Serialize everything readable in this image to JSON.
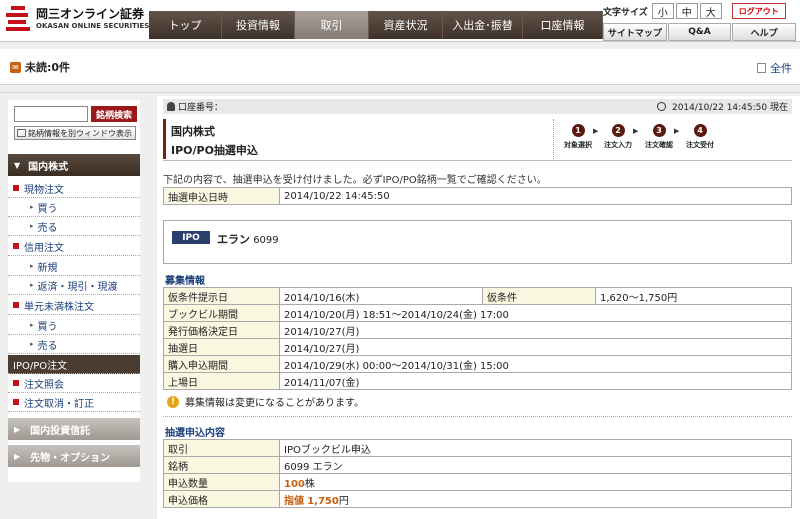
{
  "header": {
    "logo_jp": "岡三オンライン証券",
    "logo_en": "OKASAN ONLINE SECURITIES",
    "nav": [
      {
        "label": "トップ",
        "w": 73
      },
      {
        "label": "投資情報",
        "w": 73
      },
      {
        "label": "取引",
        "w": 74,
        "active": true
      },
      {
        "label": "資産状況",
        "w": 74
      },
      {
        "label": "入出金･振替",
        "w": 80
      },
      {
        "label": "口座情報",
        "w": 80
      }
    ],
    "font_size_label": "文字サイズ",
    "font_sizes": [
      "小",
      "中",
      "大"
    ],
    "logout": "ログアウト",
    "sub_links": [
      "サイトマップ",
      "Q&A",
      "ヘルプ"
    ]
  },
  "notice": {
    "unread": "未読:0件",
    "all": "全件"
  },
  "sidebar": {
    "search_btn": "銘柄検索",
    "search_placeholder": "",
    "window_btn": "銘柄情報を別ウィンドウ表示",
    "section_domestic": "国内株式",
    "items": [
      {
        "label": "現物注文",
        "level": 1
      },
      {
        "label": "買う",
        "level": 2
      },
      {
        "label": "売る",
        "level": 2
      },
      {
        "label": "信用注文",
        "level": 1
      },
      {
        "label": "新規",
        "level": 2
      },
      {
        "label": "返済・現引・現渡",
        "level": 2
      },
      {
        "label": "単元未満株注文",
        "level": 1
      },
      {
        "label": "買う",
        "level": 2
      },
      {
        "label": "売る",
        "level": 2
      },
      {
        "label": "IPO/PO注文",
        "level": 1,
        "active": true
      },
      {
        "label": "注文照会",
        "level": 1
      },
      {
        "label": "注文取消・訂正",
        "level": 1
      }
    ],
    "section_trust": "国内投資信託",
    "section_futures": "先物・オプション"
  },
  "main": {
    "account_label": "口座番号：",
    "timestamp": "2014/10/22 14:45:50 現在",
    "title1": "国内株式",
    "title2": "IPO/PO抽選申込",
    "steps": [
      "対象選択",
      "注文入力",
      "注文確認",
      "注文受付"
    ],
    "message": "下記の内容で、抽選申込を受け付けました。必ずIPO/PO銘柄一覧でご確認ください。",
    "apply_datetime_label": "抽選申込日時",
    "apply_datetime": "2014/10/22 14:45:50",
    "ipo_badge": "IPO",
    "ipo_name": "エラン",
    "ipo_code": "6099",
    "info_heading": "募集情報",
    "info": {
      "kari_date_label": "仮条件提示日",
      "kari_date": "2014/10/16(木)",
      "kari_label": "仮条件",
      "kari": "1,620～1,750円",
      "bb_label": "ブックビル期間",
      "bb": "2014/10/20(月) 18:51～2014/10/24(金) 17:00",
      "price_date_label": "発行価格決定日",
      "price_date": "2014/10/27(月)",
      "lottery_label": "抽選日",
      "lottery": "2014/10/27(月)",
      "purchase_label": "購入申込期間",
      "purchase": "2014/10/29(水) 00:00～2014/10/31(金) 15:00",
      "listing_label": "上場日",
      "listing": "2014/11/07(金)"
    },
    "note": "募集情報は変更になることがあります。",
    "app_heading": "抽選申込内容",
    "app": {
      "type_label": "取引",
      "type": "IPOブックビル申込",
      "stock_label": "銘柄",
      "stock": "6099 エラン",
      "qty_label": "申込数量",
      "qty": "100",
      "qty_unit": "株",
      "price_label": "申込価格",
      "price_kind": "指値",
      "price": "1,750",
      "price_unit": "円"
    }
  }
}
